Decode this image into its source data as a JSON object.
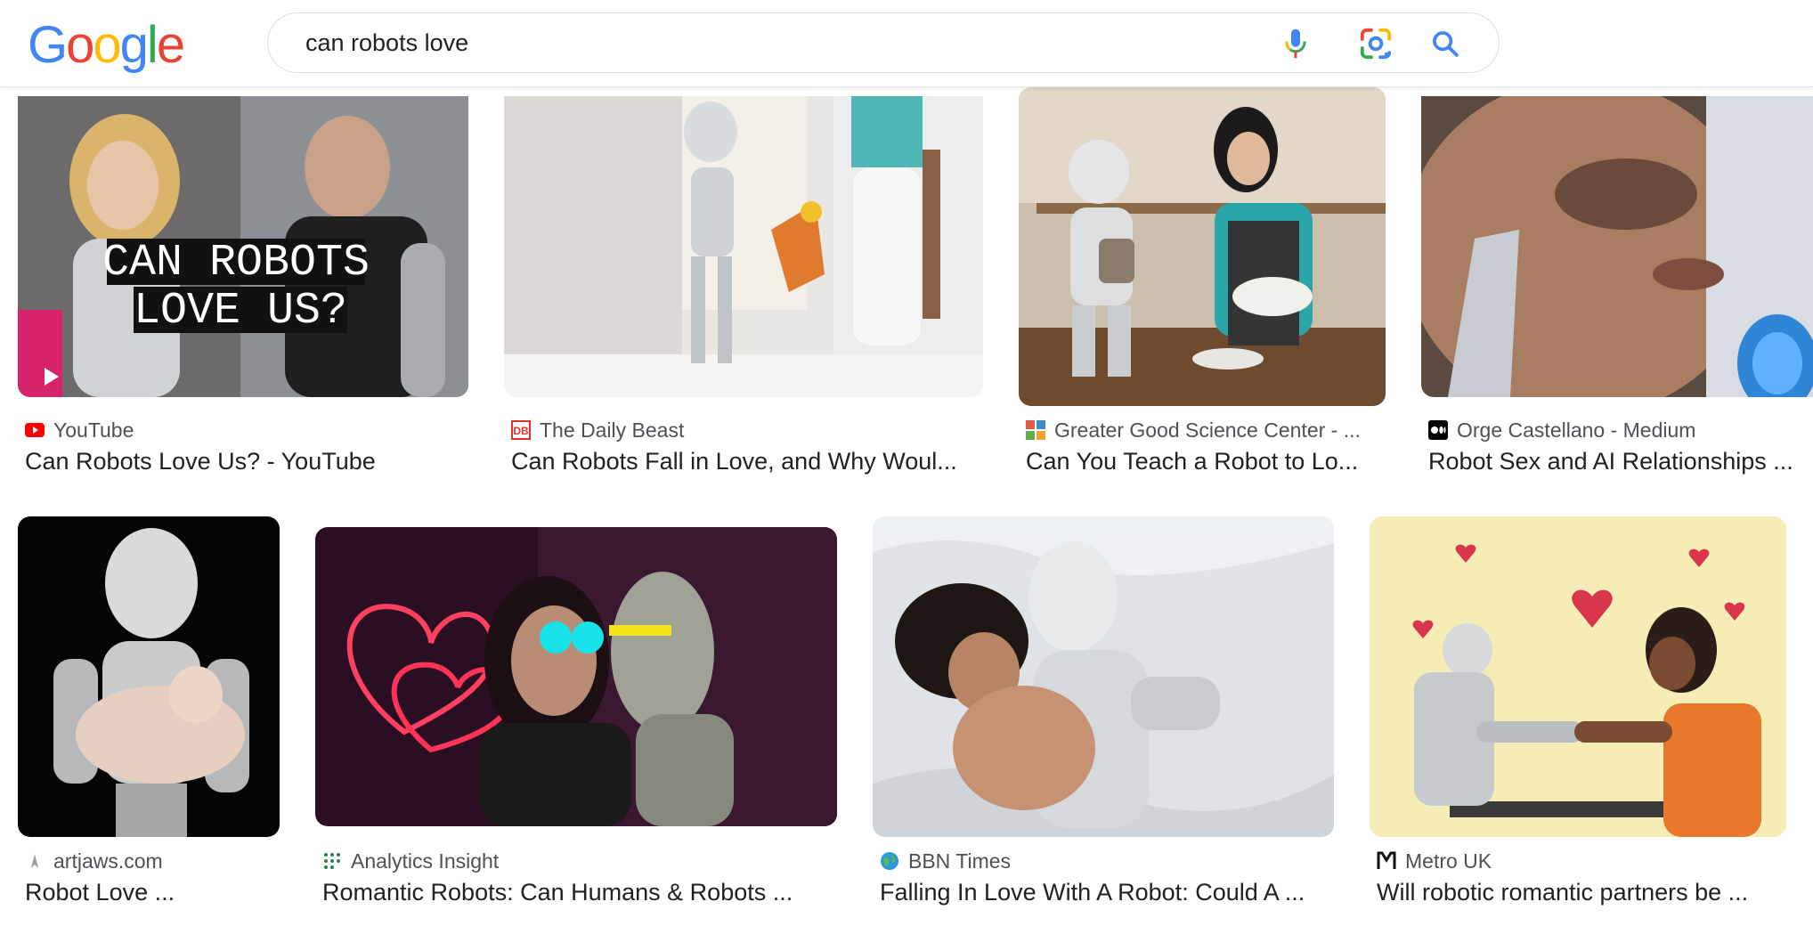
{
  "search": {
    "query": "can robots love"
  },
  "logo": {
    "letters": [
      "G",
      "o",
      "o",
      "g",
      "l",
      "e"
    ]
  },
  "results": [
    {
      "source": "YouTube",
      "title": "Can Robots Love Us? - YouTube",
      "overlay_text_line1": "CAN ROBOTS",
      "overlay_text_line2": "LOVE US?",
      "icon": "youtube-icon"
    },
    {
      "source": "The Daily Beast",
      "title": "Can Robots Fall in Love, and Why Woul...",
      "icon": "daily-beast-icon"
    },
    {
      "source": "Greater Good Science Center - ...",
      "title": "Can You Teach a Robot to Lo...",
      "icon": "greater-good-icon"
    },
    {
      "source": "Orge Castellano - Medium",
      "title": "Robot Sex and AI Relationships ...",
      "icon": "medium-icon"
    },
    {
      "source": "artjaws.com",
      "title": "Robot Love ...",
      "icon": "artjaws-icon"
    },
    {
      "source": "Analytics Insight",
      "title": "Romantic Robots: Can Humans & Robots ...",
      "icon": "analytics-insight-icon"
    },
    {
      "source": "BBN Times",
      "title": "Falling In Love With A Robot: Could A ...",
      "icon": "globe-icon"
    },
    {
      "source": "Metro UK",
      "title": "Will robotic romantic partners be ...",
      "icon": "metro-icon"
    }
  ],
  "colors": {
    "google_blue": "#4285f4",
    "google_red": "#ea4335",
    "google_yellow": "#fbbc05",
    "google_green": "#34a853",
    "text_primary": "#202124",
    "text_secondary": "#4d5156"
  }
}
